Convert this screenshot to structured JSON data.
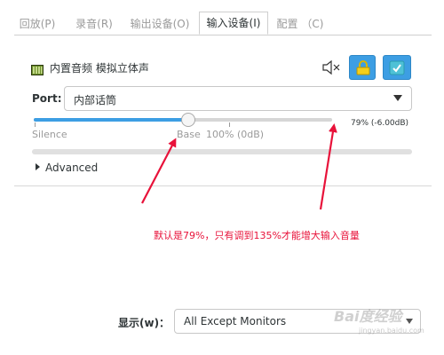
{
  "tabs": [
    {
      "label": "回放(P)",
      "active": false
    },
    {
      "label": "录音(R)",
      "active": false
    },
    {
      "label": "输出设备(O)",
      "active": false
    },
    {
      "label": "输入设备(I)",
      "active": true
    },
    {
      "label": "配置 （C)",
      "active": false
    }
  ],
  "device": {
    "title": "内置音频 模拟立体声",
    "icon": "sound-card-icon",
    "mute_icon": "speaker-mute-icon",
    "lock_icon": "lock-icon",
    "default_icon": "checkmark-icon"
  },
  "port": {
    "label": "Port:",
    "value": "内部话筒"
  },
  "volume": {
    "level_percent": 79,
    "readout": "79% (-6.00dB)",
    "silence_label": "Silence",
    "base_label": "Base",
    "hundred_label": "100% (0dB)"
  },
  "advanced": {
    "label": "Advanced"
  },
  "annotation": {
    "text": "默认是79%，只有调到135%才能增大输入音量",
    "color": "#e8123a"
  },
  "show": {
    "label": "显示(w)：",
    "value": "All Except Monitors"
  },
  "watermark": {
    "text": "Bai度经验",
    "sub": "jingyan.baidu.com"
  },
  "colors": {
    "accent": "#3d9ee3"
  }
}
